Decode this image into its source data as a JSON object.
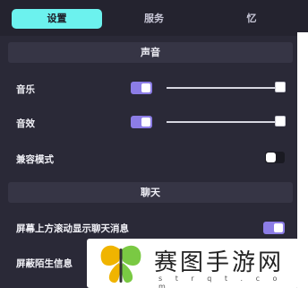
{
  "tabs": [
    {
      "label": "设置",
      "active": true
    },
    {
      "label": "服务",
      "active": false
    },
    {
      "label": "忆",
      "active": false
    }
  ],
  "sections": {
    "sound": {
      "title": "声音",
      "music": {
        "label": "音乐",
        "enabled": true,
        "volume": 1.0
      },
      "sfx": {
        "label": "音效",
        "enabled": true,
        "volume": 1.0
      },
      "compat": {
        "label": "兼容模式",
        "enabled": false
      }
    },
    "chat": {
      "title": "聊天",
      "scroll_msgs": {
        "label": "屏幕上方滚动显示聊天消息",
        "enabled": true
      },
      "block_strangers": {
        "label": "屏蔽陌生信息"
      }
    }
  },
  "colors": {
    "active_tab": "#6cf2ee",
    "toggle_on": "#8c7de6"
  },
  "watermark": {
    "text": "赛图手游网",
    "url": "s t r q t . c o m",
    "logo": "butterfly-logo"
  }
}
